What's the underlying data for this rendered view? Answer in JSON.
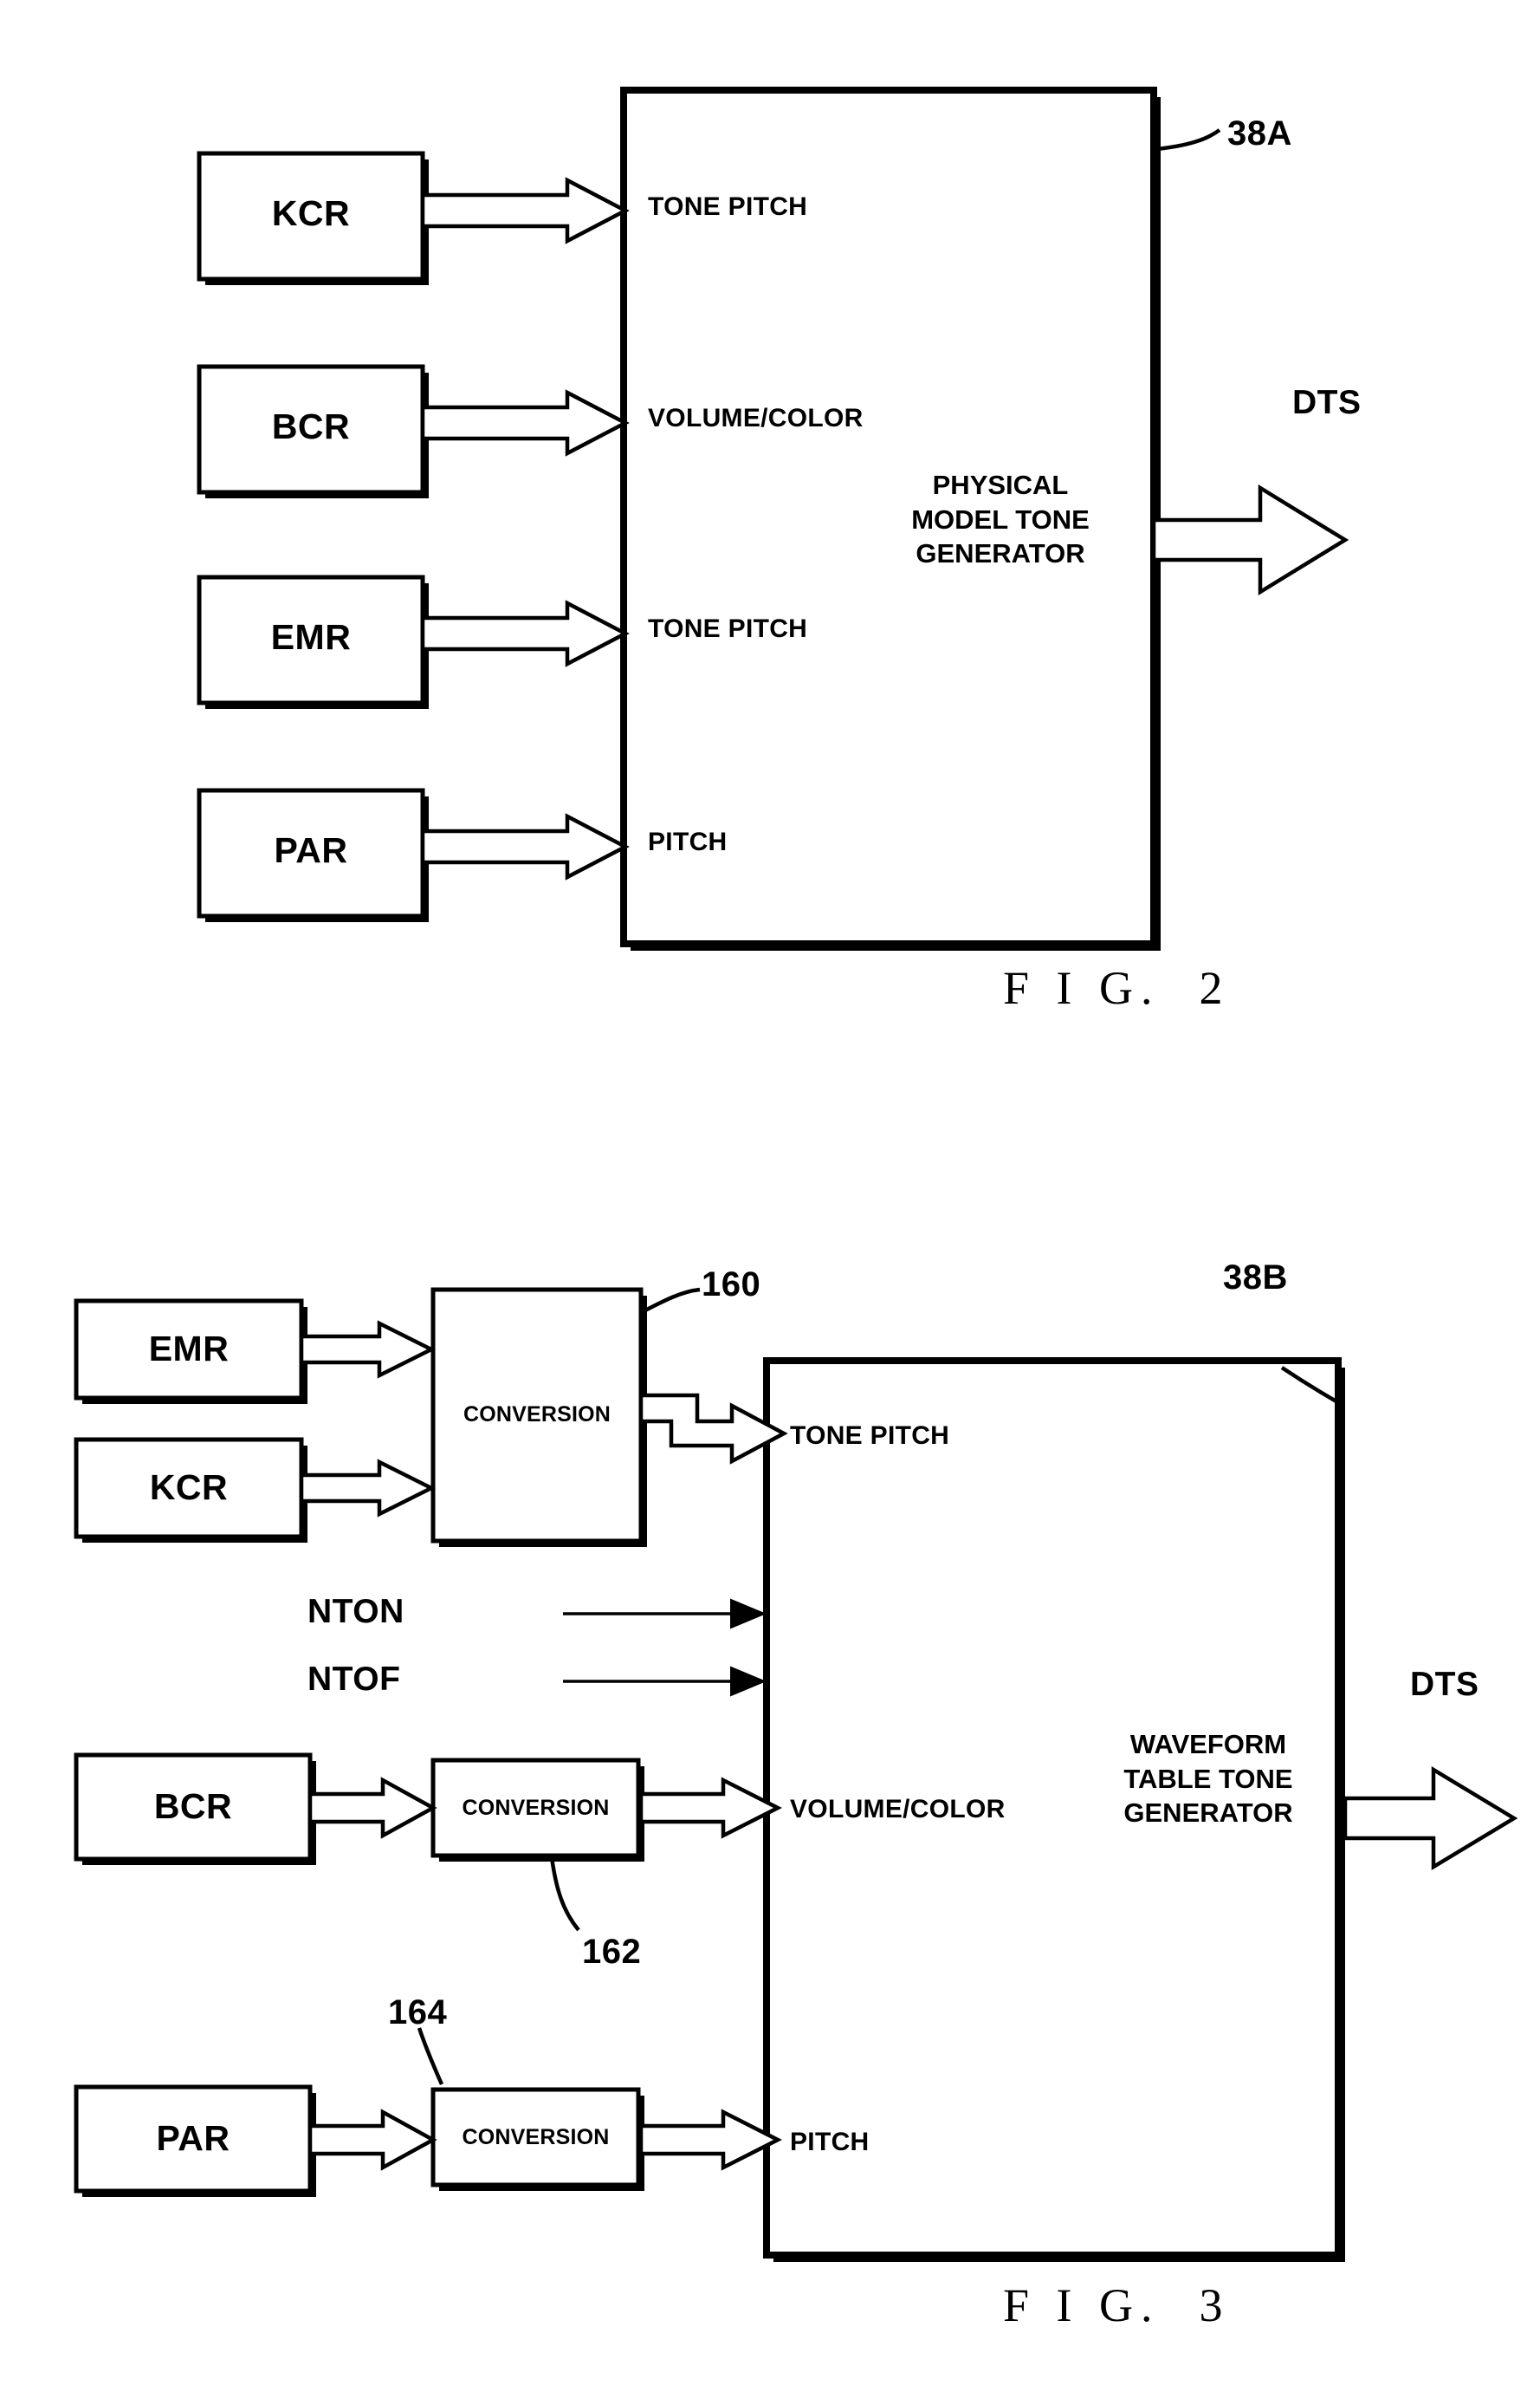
{
  "figures": [
    {
      "id": "fig2",
      "caption": "F I G.  2",
      "ref": "38A",
      "generator": "PHYSICAL\nMODEL TONE\nGENERATOR",
      "output": "DTS",
      "sources": [
        {
          "label": "KCR",
          "port": "TONE PITCH"
        },
        {
          "label": "BCR",
          "port": "VOLUME/COLOR"
        },
        {
          "label": "EMR",
          "port": "TONE PITCH"
        },
        {
          "label": "PAR",
          "port": "PITCH"
        }
      ]
    },
    {
      "id": "fig3",
      "caption": "F I G.  3",
      "ref": "38B",
      "generator": "WAVEFORM\nTABLE TONE\nGENERATOR",
      "output": "DTS",
      "conversion_label": "CONVERSION",
      "conversion_refs": [
        "160",
        "162",
        "164"
      ],
      "direct_signals": [
        "NTON",
        "NTOF"
      ],
      "sources": [
        {
          "label": "EMR"
        },
        {
          "label": "KCR"
        },
        {
          "label": "BCR"
        },
        {
          "label": "PAR"
        }
      ],
      "ports": [
        "TONE PITCH",
        "VOLUME/COLOR",
        "PITCH"
      ]
    }
  ],
  "colors": {
    "ink": "#000000",
    "paper": "#ffffff"
  }
}
